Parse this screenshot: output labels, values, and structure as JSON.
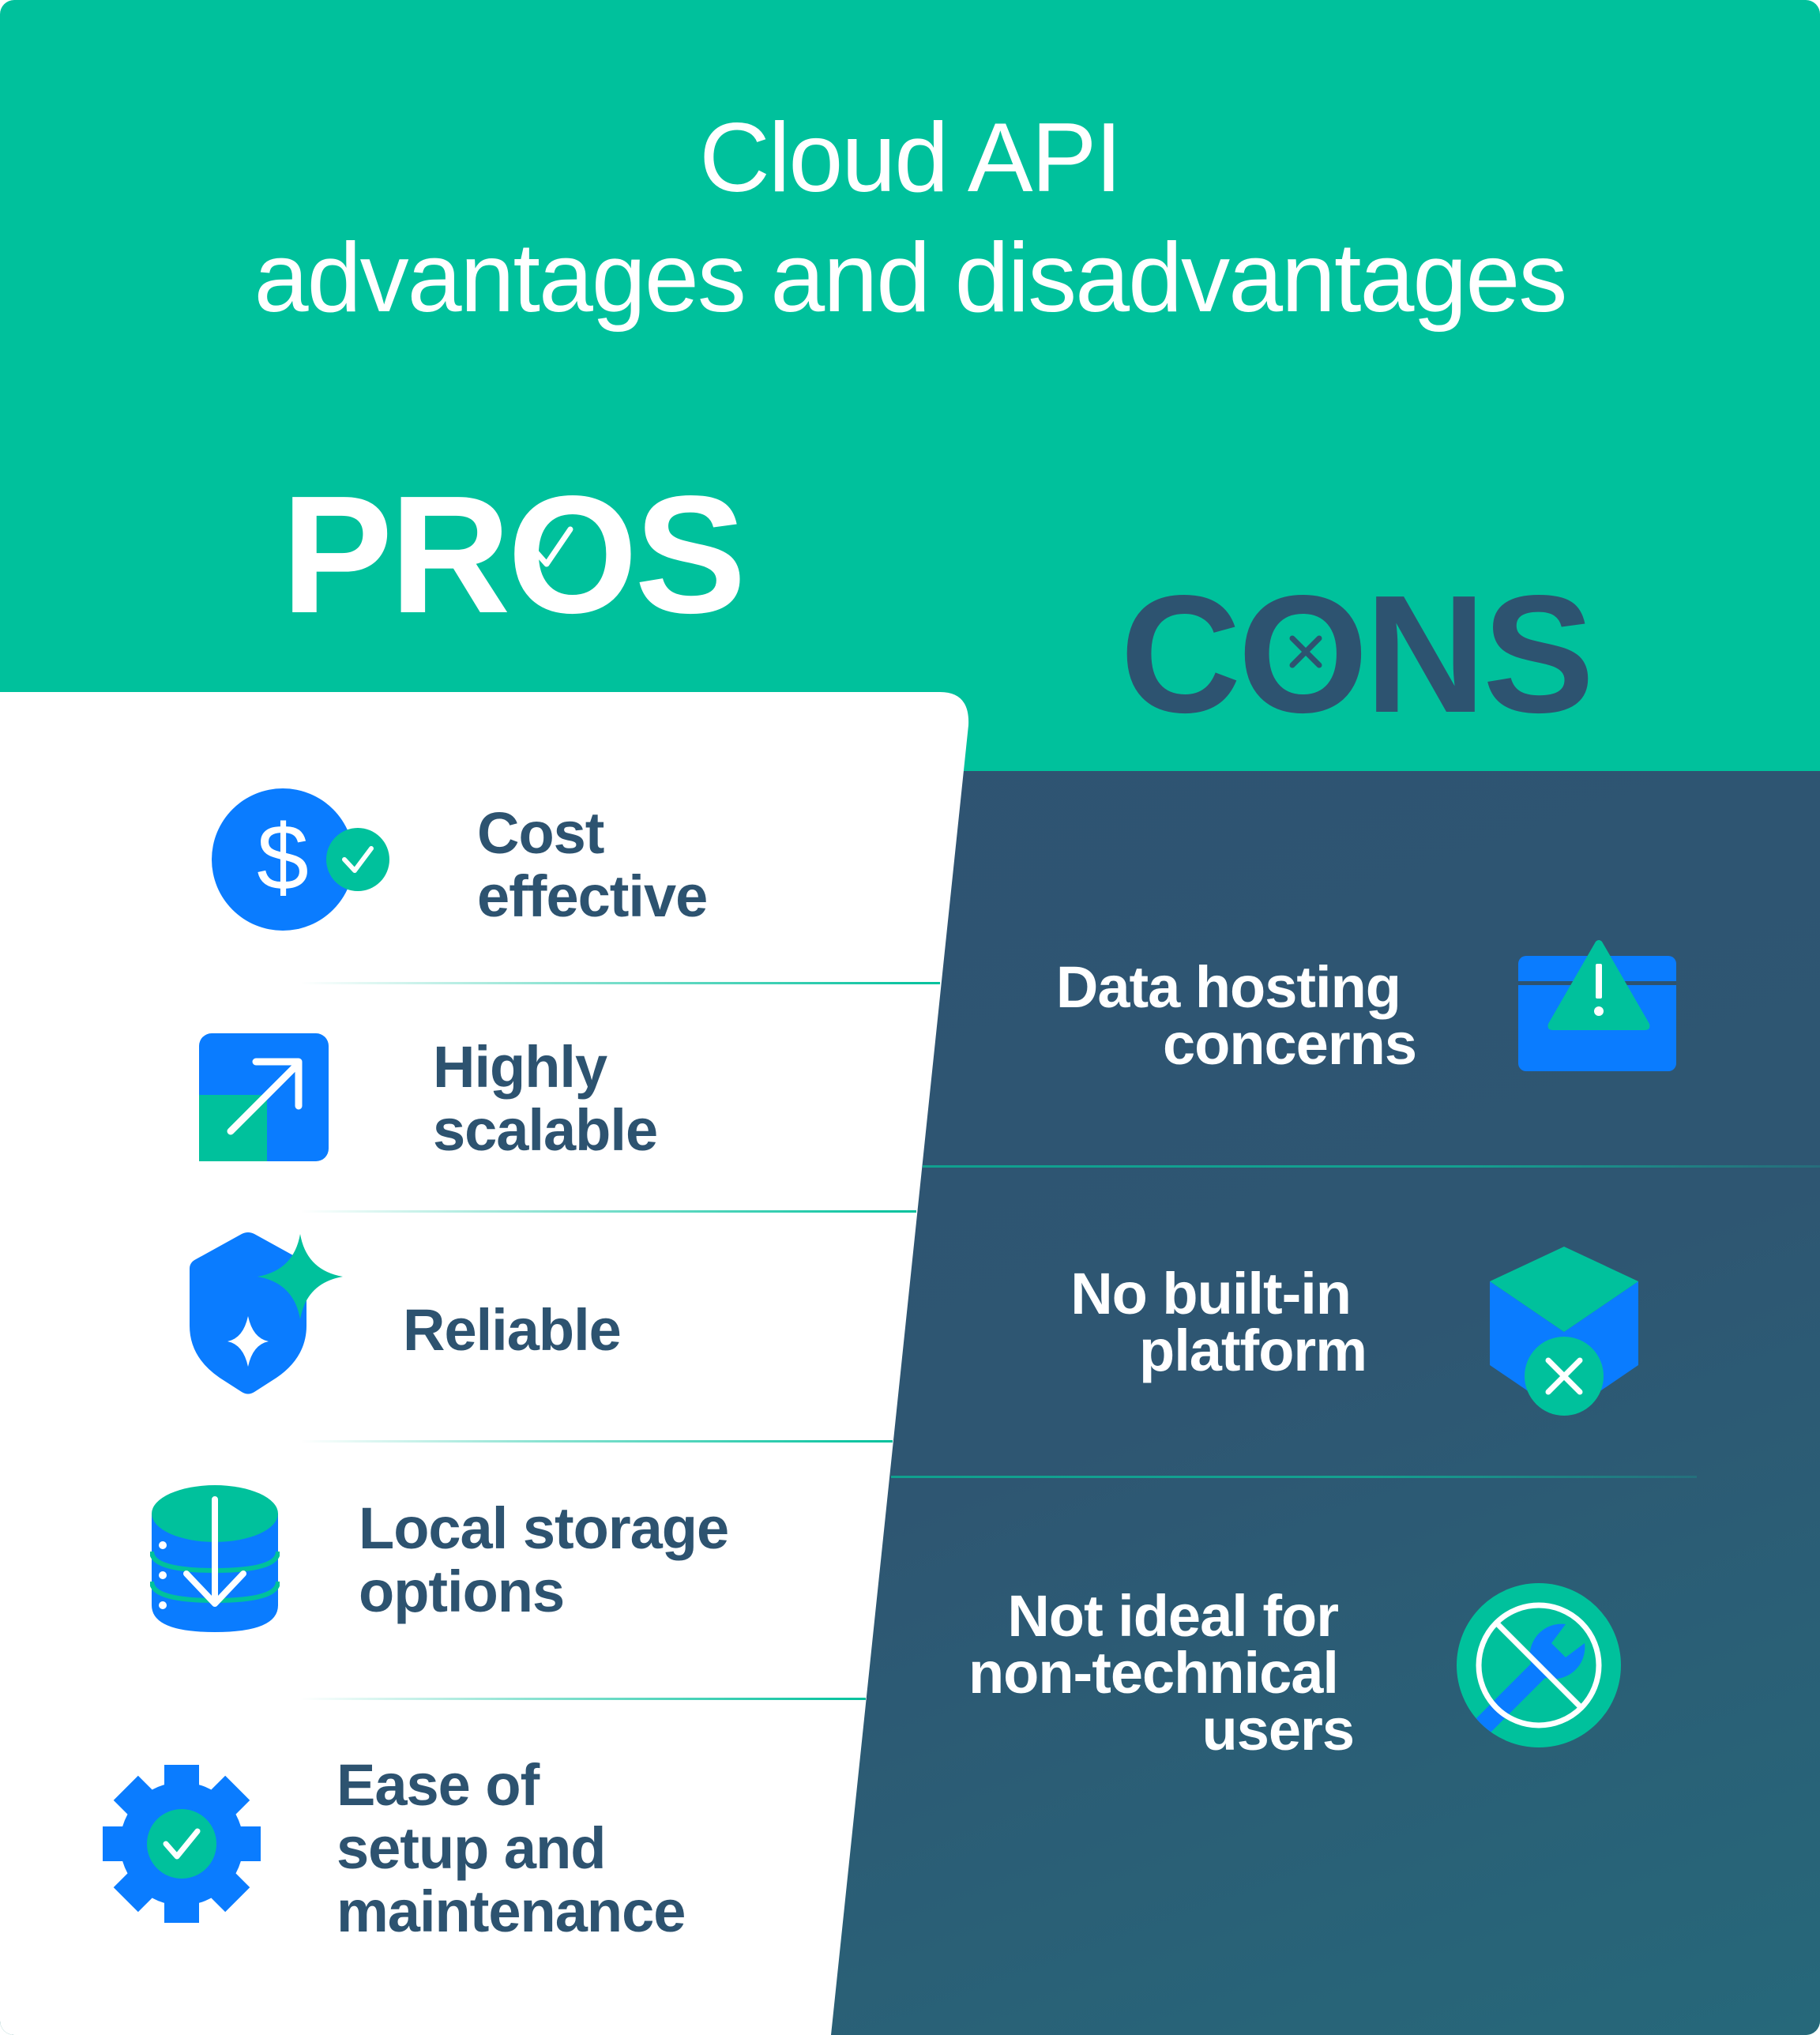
{
  "title": {
    "line1": "Cloud API",
    "line2": "advantages and disadvantages"
  },
  "pros": {
    "heading": "PROS",
    "heading_icon": "check-mark-icon",
    "items": [
      {
        "lines": [
          "Cost",
          "effective"
        ],
        "icon": "dollar-check-icon"
      },
      {
        "lines": [
          "Highly",
          "scalable"
        ],
        "icon": "scale-up-arrow-icon"
      },
      {
        "lines": [
          "Reliable"
        ],
        "icon": "shield-sparkle-icon"
      },
      {
        "lines": [
          "Local storage",
          "options"
        ],
        "icon": "database-download-icon"
      },
      {
        "lines": [
          "Ease of",
          "setup and",
          "maintenance"
        ],
        "icon": "gear-check-icon"
      }
    ]
  },
  "cons": {
    "heading": "CONS",
    "heading_icon": "x-mark-icon",
    "items": [
      {
        "lines": [
          "Data hosting",
          "concerns"
        ],
        "icon": "browser-warning-icon"
      },
      {
        "lines": [
          "No built-in",
          "platform"
        ],
        "icon": "box-x-icon"
      },
      {
        "lines": [
          "Not ideal for",
          "non-technical",
          "users"
        ],
        "icon": "no-wrench-icon"
      }
    ]
  },
  "colors": {
    "brand_green": "#00c19c",
    "navy": "#2d5370",
    "blue": "#0a7cff",
    "white": "#ffffff"
  }
}
